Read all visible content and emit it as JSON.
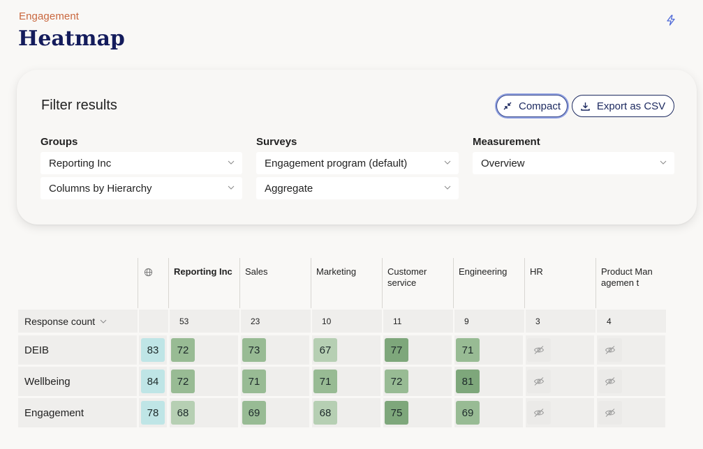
{
  "breadcrumb": "Engagement",
  "title": "Heatmap",
  "filter": {
    "title": "Filter results",
    "compact_label": "Compact",
    "export_label": "Export as CSV",
    "groups_label": "Groups",
    "surveys_label": "Surveys",
    "measurement_label": "Measurement",
    "groups_value": "Reporting Inc",
    "columns_value": "Columns by Hierarchy",
    "survey_value": "Engagement program (default)",
    "aggregate_value": "Aggregate",
    "measurement_value": "Overview"
  },
  "heatmap": {
    "columns": [
      "Reporting Inc",
      "Sales",
      "Marketing",
      "Customer service",
      "Engineering",
      "HR",
      "Product Managemen t"
    ],
    "response_count_label": "Response count",
    "counts": [
      "53",
      "23",
      "10",
      "11",
      "9",
      "3",
      "4"
    ],
    "rows": [
      {
        "label": "DEIB",
        "benchmark": "83",
        "values": [
          "72",
          "73",
          "67",
          "77",
          "71",
          null,
          null
        ]
      },
      {
        "label": "Wellbeing",
        "benchmark": "84",
        "values": [
          "72",
          "71",
          "71",
          "72",
          "81",
          null,
          null
        ]
      },
      {
        "label": "Engagement",
        "benchmark": "78",
        "values": [
          "68",
          "69",
          "68",
          "75",
          "69",
          null,
          null
        ]
      }
    ]
  },
  "colors": {
    "accent": "#c9673e",
    "title": "#141c5c",
    "benchmark": "#bfe5e6",
    "score_light": "#b6cfb3",
    "score_mid": "#98bb94",
    "score_dark": "#7ea77b"
  }
}
